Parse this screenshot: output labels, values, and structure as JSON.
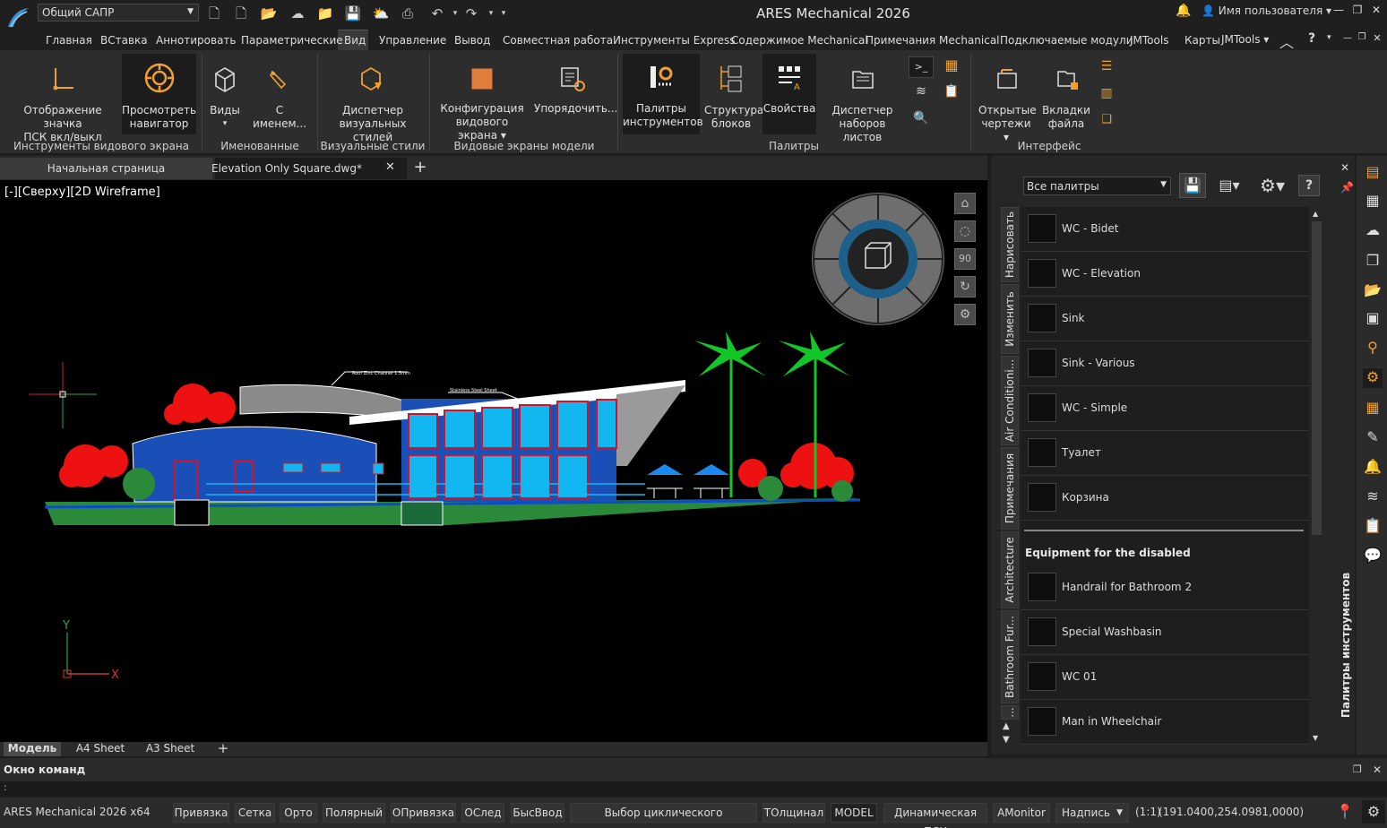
{
  "app": {
    "title": "ARES Mechanical 2026",
    "workspace": "Общий САПР",
    "user": "Имя пользователя"
  },
  "menu": [
    "Главная",
    "ВСтавка",
    "Аннотировать",
    "Параметрические",
    "Вид",
    "Управление",
    "Вывод",
    "Совместная работа",
    "Инструменты Express",
    "Содержимое Mechanical",
    "Примечания Mechanical",
    "Подключаемые модули",
    "JMTools",
    "Карты"
  ],
  "menu_right": "JMTools",
  "ribbon": {
    "b1": [
      "Отображение значка",
      "ПСК вкл/выкл"
    ],
    "b2": [
      "Просмотреть",
      "навигатор"
    ],
    "b3": "Виды",
    "b4": "С именем...",
    "b5": [
      "Диспетчер",
      "визуальных стилей"
    ],
    "b6": [
      "Конфигурация",
      "видового экрана"
    ],
    "b7": "Упорядочить...",
    "b8": [
      "Палитры",
      "инструментов"
    ],
    "b9": [
      "Структура",
      "блоков"
    ],
    "b10": "Свойства",
    "b11": [
      "Диспетчер",
      "наборов листов"
    ],
    "b12": [
      "Открытые",
      "чертежи"
    ],
    "b13": [
      "Вкладки",
      "файла"
    ],
    "groups": [
      "Инструменты видового экрана",
      "Именованные виды",
      "Визуальные стили",
      "Видовые экраны модели",
      "Палитры",
      "Интерфейс"
    ]
  },
  "doctabs": [
    "Начальная страница",
    "Elevation Only Square.dwg*"
  ],
  "viewport": {
    "label": "[-][Сверху][2D Wireframe]",
    "nav_90": "90",
    "annot1": "Roof Zinc Channel 1.5mm",
    "annot2": "Stainless Steel Sheet"
  },
  "layouts": [
    "Модель",
    "A4 Sheet",
    "A3 Sheet"
  ],
  "palette": {
    "filter": "Все палитры",
    "tabs": [
      "Нарисовать",
      "Изменить",
      "Air Conditioni...",
      "Примечания",
      "Architecture",
      "Bathroom Fur...",
      "..."
    ],
    "items": [
      "WC - Bidet",
      "WC - Elevation",
      "Sink",
      "Sink - Various",
      "WC - Simple",
      "Туалет",
      "Корзина"
    ],
    "section": "Equipment for the disabled",
    "items2": [
      "Handrail for Bathroom 2",
      "Special Washbasin",
      "WC 01",
      "Man in Wheelchair"
    ],
    "title": "Палитры инструментов"
  },
  "command": {
    "title": "Окно команд",
    "prompt": ":"
  },
  "status": {
    "product": "ARES Mechanical 2026 x64",
    "buttons": [
      "Привязка",
      "Сетка",
      "Орто",
      "Полярный",
      "ОПривязка",
      "ОСлед",
      "БысВвод",
      "Выбор циклического переключения",
      "ТОлщинал",
      "MODEL",
      "Динамическая ПСК",
      "AMonitor",
      "Надпись"
    ],
    "scale": "(1:1)",
    "coords": "(191.0400,254.0981,0000)"
  }
}
